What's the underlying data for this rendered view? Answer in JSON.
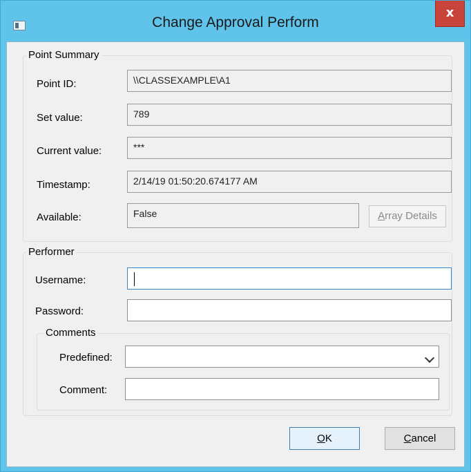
{
  "window": {
    "title": "Change Approval Perform",
    "close_glyph": "x"
  },
  "point_summary": {
    "legend": "Point Summary",
    "point_id_label": "Point ID:",
    "point_id_value": "\\\\CLASSEXAMPLE\\A1",
    "set_value_label": "Set value:",
    "set_value_value": "789",
    "current_value_label": "Current value:",
    "current_value_value": "***",
    "timestamp_label": "Timestamp:",
    "timestamp_value": "2/14/19  01:50:20.674177 AM",
    "available_label": "Available:",
    "available_value": "False",
    "array_details_button": {
      "mnemonic": "A",
      "rest": "rray Details"
    }
  },
  "performer": {
    "legend": "Performer",
    "username_label": "Username:",
    "username_value": "",
    "password_label": "Password:",
    "password_value": "",
    "comments": {
      "legend": "Comments",
      "predefined_label": "Predefined:",
      "predefined_value": "",
      "comment_label": "Comment:",
      "comment_value": ""
    }
  },
  "buttons": {
    "ok": {
      "mnemonic": "O",
      "rest": "K"
    },
    "cancel": {
      "mnemonic": "C",
      "rest": "ancel"
    }
  },
  "icons": {
    "app": "window-app-icon",
    "close": "close-icon",
    "dropdown": "chevron-down-icon"
  },
  "colors": {
    "titlebar": "#5fc3ea",
    "close": "#c8443a",
    "dialog": "#f0f0f0",
    "focus": "#3a86c8"
  }
}
